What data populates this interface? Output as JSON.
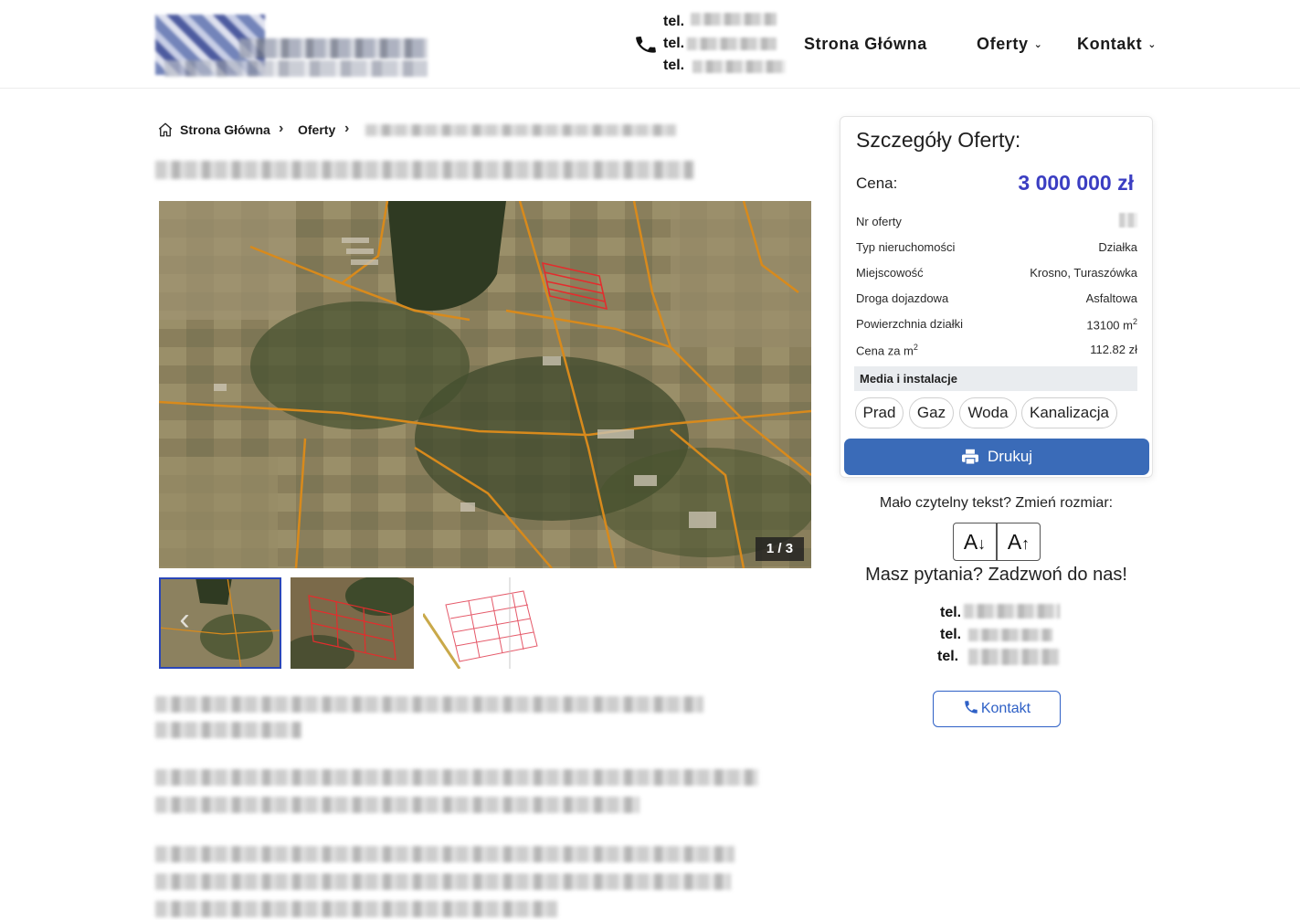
{
  "header": {
    "phones": [
      {
        "label": "tel."
      },
      {
        "label": "tel."
      },
      {
        "label": "tel."
      }
    ],
    "nav": [
      {
        "label": "Strona Główna"
      },
      {
        "label": "Oferty"
      },
      {
        "label": "Kontakt"
      }
    ]
  },
  "breadcrumb": {
    "home": "Strona Główna",
    "offers": "Oferty"
  },
  "gallery": {
    "counter": "1 / 3",
    "current": 1,
    "total": 3
  },
  "details": {
    "title": "Szczegóły Oferty:",
    "price_label": "Cena:",
    "price_value": "3 000 000 zł",
    "rows": [
      {
        "label": "Nr oferty",
        "value": ""
      },
      {
        "label": "Typ nieruchomości",
        "value": "Działka"
      },
      {
        "label": "Miejscowość",
        "value": "Krosno, Turaszówka"
      },
      {
        "label": "Droga dojazdowa",
        "value": "Asfaltowa"
      },
      {
        "label": "Powierzchnia działki",
        "value": "13100 m",
        "sup": "2"
      },
      {
        "label": "Cena za m",
        "label_sup": "2",
        "value": "112.82 zł"
      }
    ],
    "media_heading": "Media i instalacje",
    "media": [
      "Prad",
      "Gaz",
      "Woda",
      "Kanalizacja"
    ],
    "print_label": "Drukuj"
  },
  "sidebar": {
    "resize_text": "Mało czytelny tekst? Zmień rozmiar:",
    "decrease_label": "A",
    "increase_label": "A",
    "ask_text": "Masz pytania? Zadzwoń do nas!",
    "phones": [
      {
        "label": "tel."
      },
      {
        "label": "tel."
      },
      {
        "label": "tel."
      }
    ],
    "contact_label": "Kontakt"
  },
  "colors": {
    "price": "#3b3ec2",
    "print_button": "#3a6bb8",
    "contact_button": "#2e60c6",
    "thumb_active": "#2a46b8"
  }
}
